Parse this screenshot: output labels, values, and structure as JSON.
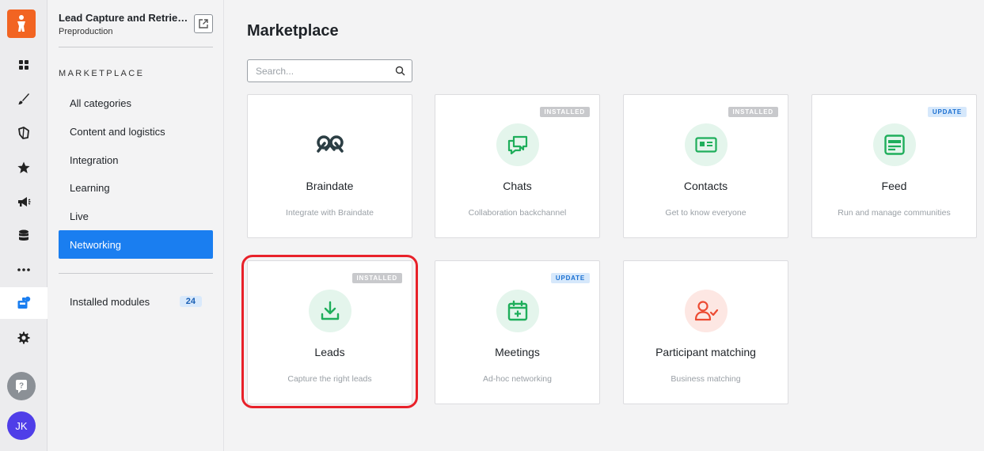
{
  "sidebar": {
    "event_title": "Lead Capture and Retrieva...",
    "event_sub": "Preproduction",
    "section_label": "MARKETPLACE",
    "categories": [
      {
        "label": "All categories",
        "active": false
      },
      {
        "label": "Content and logistics",
        "active": false
      },
      {
        "label": "Integration",
        "active": false
      },
      {
        "label": "Learning",
        "active": false
      },
      {
        "label": "Live",
        "active": false
      },
      {
        "label": "Networking",
        "active": true
      }
    ],
    "installed_label": "Installed modules",
    "installed_count": "24"
  },
  "rail": {
    "avatar_initials": "JK",
    "icons": [
      "dashboard-icon",
      "brush-icon",
      "map-icon",
      "star-icon",
      "megaphone-icon",
      "database-icon",
      "more-icon",
      "marketplace-icon",
      "gear-icon"
    ]
  },
  "main": {
    "title": "Marketplace",
    "search_placeholder": "Search...",
    "cards": [
      {
        "name": "Braindate",
        "desc": "Integrate with Braindate",
        "badge": ""
      },
      {
        "name": "Chats",
        "desc": "Collaboration backchannel",
        "badge": "INSTALLED"
      },
      {
        "name": "Contacts",
        "desc": "Get to know everyone",
        "badge": "INSTALLED"
      },
      {
        "name": "Feed",
        "desc": "Run and manage communities",
        "badge": "UPDATE"
      },
      {
        "name": "Leads",
        "desc": "Capture the right leads",
        "badge": "INSTALLED"
      },
      {
        "name": "Meetings",
        "desc": "Ad-hoc networking",
        "badge": "UPDATE"
      },
      {
        "name": "Participant matching",
        "desc": "Business matching",
        "badge": ""
      }
    ]
  },
  "colors": {
    "accent": "#1a7ef0",
    "brand": "#f26422",
    "module_green": "#1fae5b",
    "module_red": "#ec4b33",
    "highlight": "#e8212a"
  }
}
